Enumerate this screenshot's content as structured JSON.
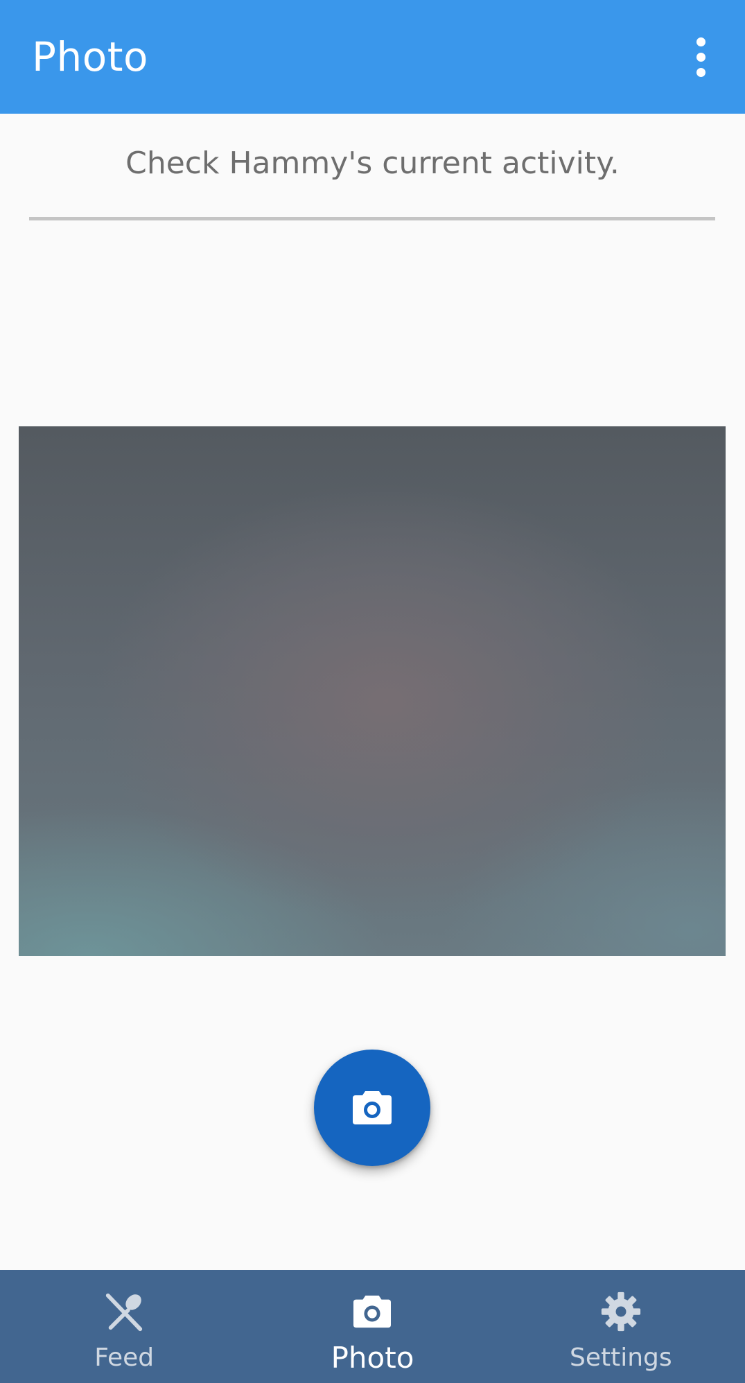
{
  "appbar": {
    "title": "Photo",
    "menu_icon": "more-vert-icon"
  },
  "main": {
    "subtitle": "Check Hammy's current activity.",
    "capture_icon": "camera-icon"
  },
  "bottom_nav": {
    "items": [
      {
        "label": "Feed",
        "icon": "spoon-knife-icon",
        "active": false
      },
      {
        "label": "Photo",
        "icon": "camera-icon",
        "active": true
      },
      {
        "label": "Settings",
        "icon": "gear-icon",
        "active": false
      }
    ]
  },
  "colors": {
    "appbar": "#3a97eb",
    "fab": "#1565c0",
    "bottom_nav": "#426690",
    "background": "#fafafa"
  }
}
